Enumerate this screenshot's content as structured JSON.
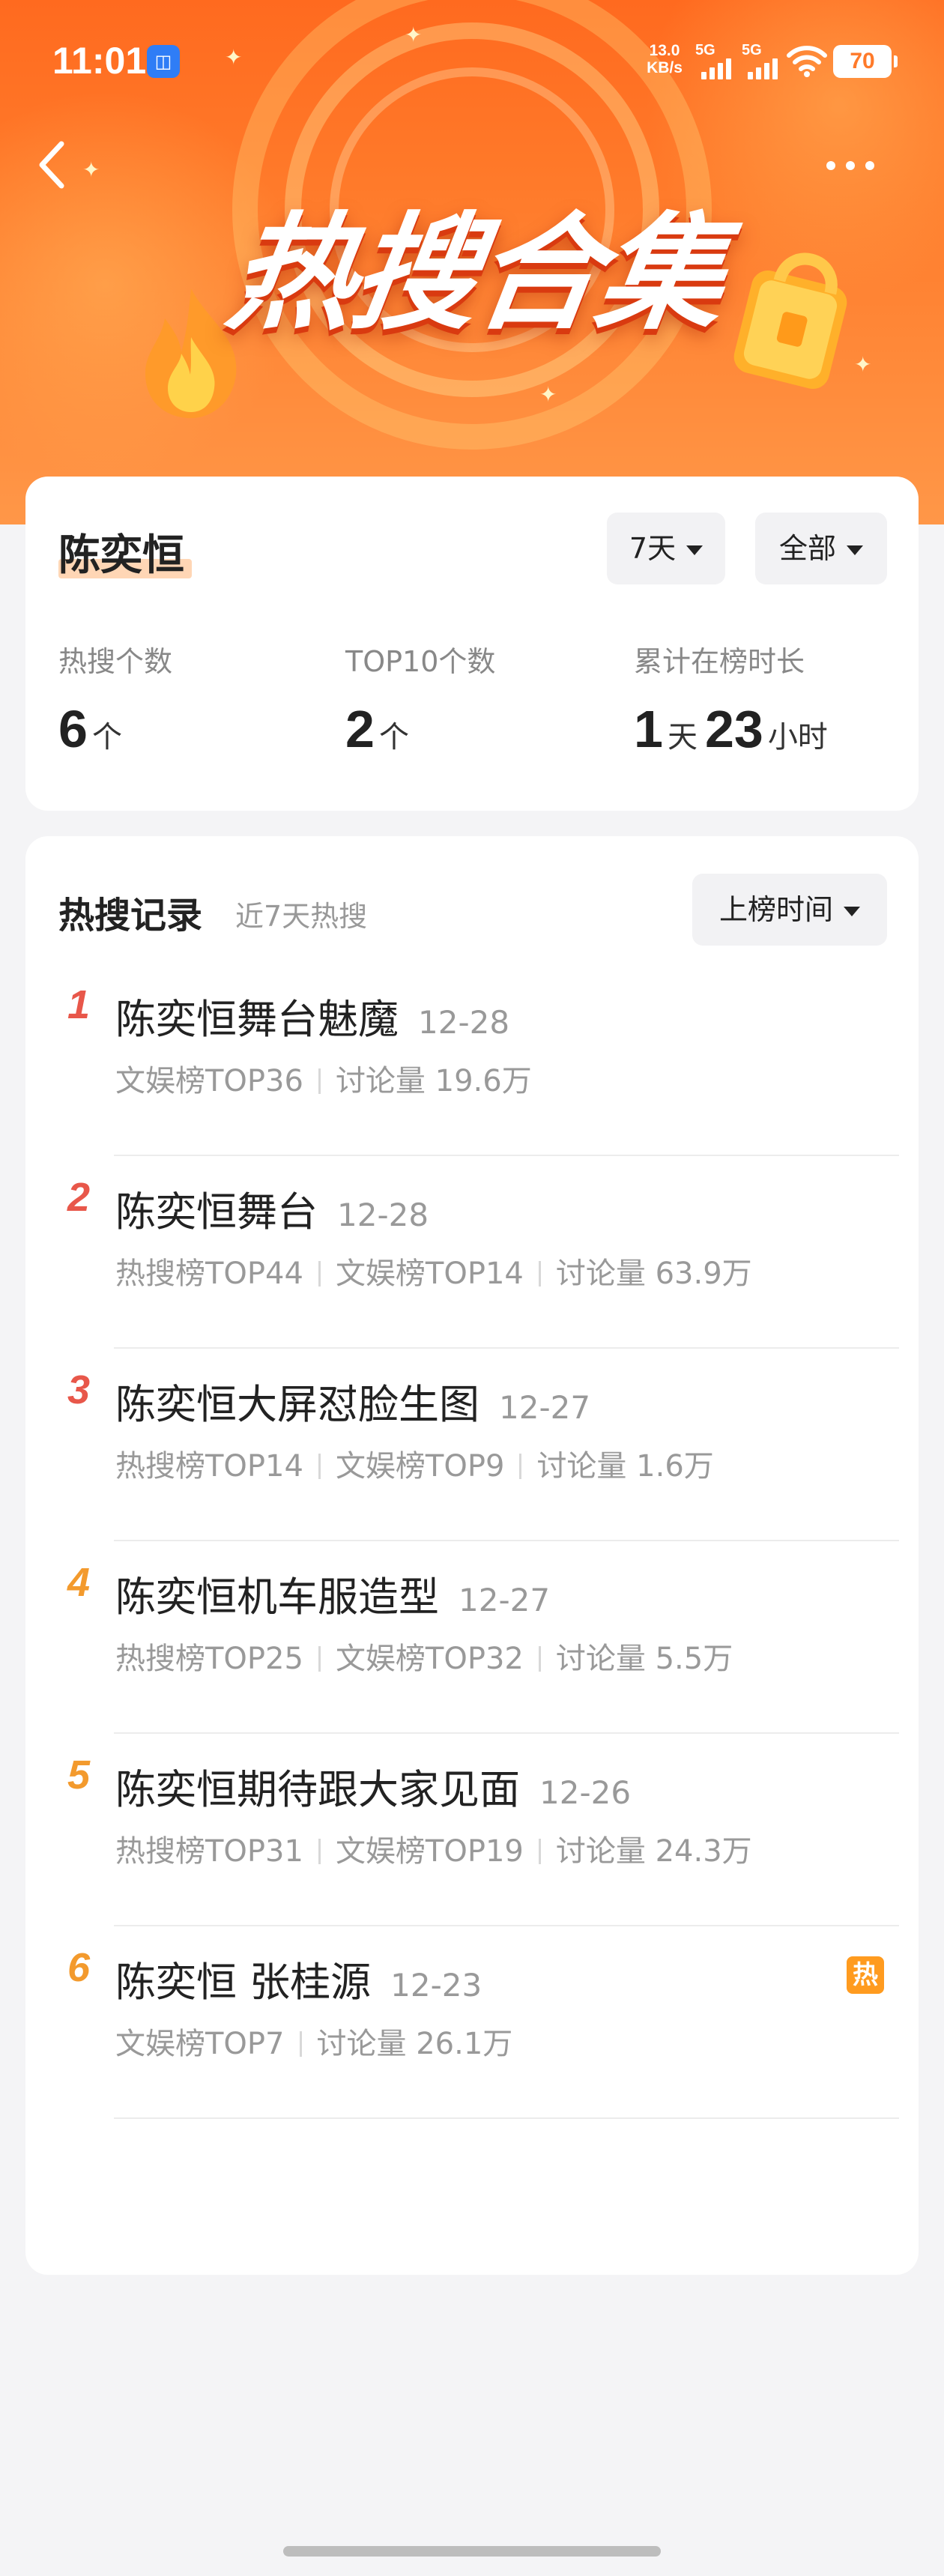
{
  "status_bar": {
    "time": "11:01",
    "net_speed_value": "13.0",
    "net_speed_unit": "KB/s",
    "signal1_label": "5G",
    "signal2_label": "5G",
    "battery": "70"
  },
  "header": {
    "banner_title": "热搜合集"
  },
  "summary": {
    "name": "陈奕恒",
    "filter_days": "7天",
    "filter_scope": "全部",
    "stats": {
      "hot_count_label": "热搜个数",
      "hot_count_value": "6",
      "hot_count_unit": "个",
      "top10_label": "TOP10个数",
      "top10_value": "2",
      "top10_unit": "个",
      "duration_label": "累计在榜时长",
      "duration_days": "1",
      "duration_days_unit": "天",
      "duration_hours": "23",
      "duration_hours_unit": "小时"
    }
  },
  "records": {
    "title": "热搜记录",
    "subtitle": "近7天热搜",
    "sort_label": "上榜时间",
    "items": [
      {
        "rank": "1",
        "topic": "陈奕恒舞台魅魔",
        "date": "12-28",
        "meta": [
          "文娱榜TOP36",
          "讨论量 19.6万"
        ],
        "hot": false
      },
      {
        "rank": "2",
        "topic": "陈奕恒舞台",
        "date": "12-28",
        "meta": [
          "热搜榜TOP44",
          "文娱榜TOP14",
          "讨论量 63.9万"
        ],
        "hot": false
      },
      {
        "rank": "3",
        "topic": "陈奕恒大屏怼脸生图",
        "date": "12-27",
        "meta": [
          "热搜榜TOP14",
          "文娱榜TOP9",
          "讨论量 1.6万"
        ],
        "hot": false
      },
      {
        "rank": "4",
        "topic": "陈奕恒机车服造型",
        "date": "12-27",
        "meta": [
          "热搜榜TOP25",
          "文娱榜TOP32",
          "讨论量 5.5万"
        ],
        "hot": false
      },
      {
        "rank": "5",
        "topic": "陈奕恒期待跟大家见面",
        "date": "12-26",
        "meta": [
          "热搜榜TOP31",
          "文娱榜TOP19",
          "讨论量 24.3万"
        ],
        "hot": false
      },
      {
        "rank": "6",
        "topic": "陈奕恒 张桂源",
        "date": "12-23",
        "meta": [
          "文娱榜TOP7",
          "讨论量 26.1万"
        ],
        "hot": true,
        "hot_label": "热"
      }
    ]
  },
  "colors": {
    "rank_top3": "#e8574a",
    "rank_rest": "#f39a2d",
    "hot_badge": "#ff9b1f",
    "banner": "#ff7a2a"
  }
}
